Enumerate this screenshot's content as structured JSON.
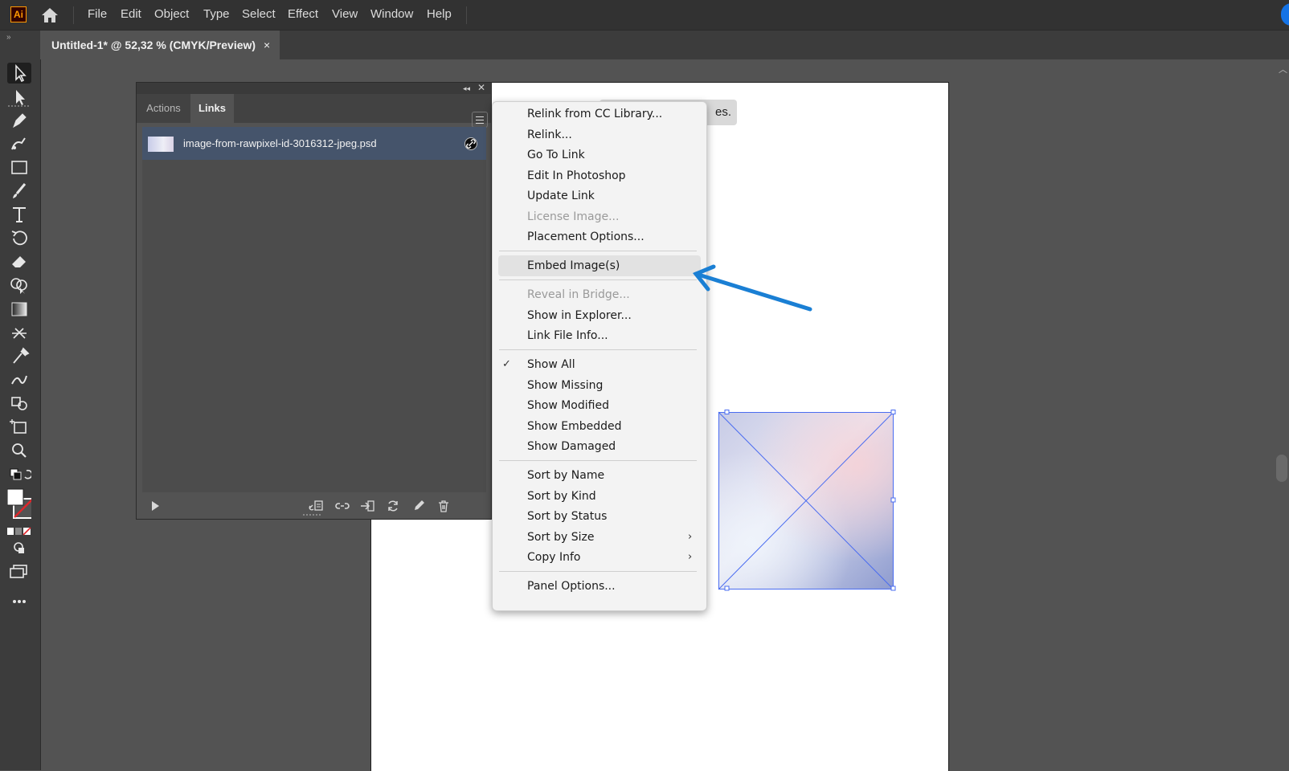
{
  "app": {
    "logo_text": "Ai",
    "menu": [
      "File",
      "Edit",
      "Object",
      "Type",
      "Select",
      "Effect",
      "View",
      "Window",
      "Help"
    ]
  },
  "document_tab": {
    "title": "Untitled-1* @ 52,32 % (CMYK/Preview)",
    "close_glyph": "×"
  },
  "tooltip": {
    "visible_text": "es."
  },
  "links_panel": {
    "tabs": [
      "Actions",
      "Links"
    ],
    "active_tab": "Links",
    "items": [
      {
        "name": "image-from-rawpixel-id-3016312-jpeg.psd",
        "status_icon": "link-icon",
        "selected": true
      }
    ],
    "footer_icons": [
      "play-icon",
      "relink-from-cc-library-icon",
      "relink-icon",
      "go-to-link-icon",
      "update-link-icon",
      "edit-original-icon",
      "delete-icon"
    ]
  },
  "context_menu": {
    "items": [
      {
        "label": "Relink from CC Library...",
        "disabled": false
      },
      {
        "label": "Relink...",
        "disabled": false
      },
      {
        "label": "Go To Link",
        "disabled": false
      },
      {
        "label": "Edit In Photoshop",
        "disabled": false
      },
      {
        "label": "Update Link",
        "disabled": false
      },
      {
        "label": "License Image...",
        "disabled": true
      },
      {
        "label": "Placement Options...",
        "disabled": false
      },
      {
        "label": "Embed Image(s)",
        "disabled": false,
        "highlighted": true
      },
      {
        "label": "Reveal in Bridge...",
        "disabled": true
      },
      {
        "label": "Show in Explorer...",
        "disabled": false
      },
      {
        "label": "Link File Info...",
        "disabled": false
      },
      {
        "label": "Show All",
        "disabled": false,
        "checked": true
      },
      {
        "label": "Show Missing",
        "disabled": false
      },
      {
        "label": "Show Modified",
        "disabled": false
      },
      {
        "label": "Show Embedded",
        "disabled": false
      },
      {
        "label": "Show Damaged",
        "disabled": false
      },
      {
        "label": "Sort by Name",
        "disabled": false
      },
      {
        "label": "Sort by Kind",
        "disabled": false
      },
      {
        "label": "Sort by Status",
        "disabled": false
      },
      {
        "label": "Sort by Size",
        "disabled": false,
        "submenu": true
      },
      {
        "label": "Copy Info",
        "disabled": false,
        "submenu": true
      },
      {
        "label": "Panel Options...",
        "disabled": false
      }
    ],
    "check_glyph": "✓",
    "submenu_glyph": "›"
  },
  "colors": {
    "accent": "#1473e6",
    "annotation_arrow": "#1a7fd4",
    "selection_bbox": "#4a6cf0",
    "selected_row": "#45546b"
  }
}
